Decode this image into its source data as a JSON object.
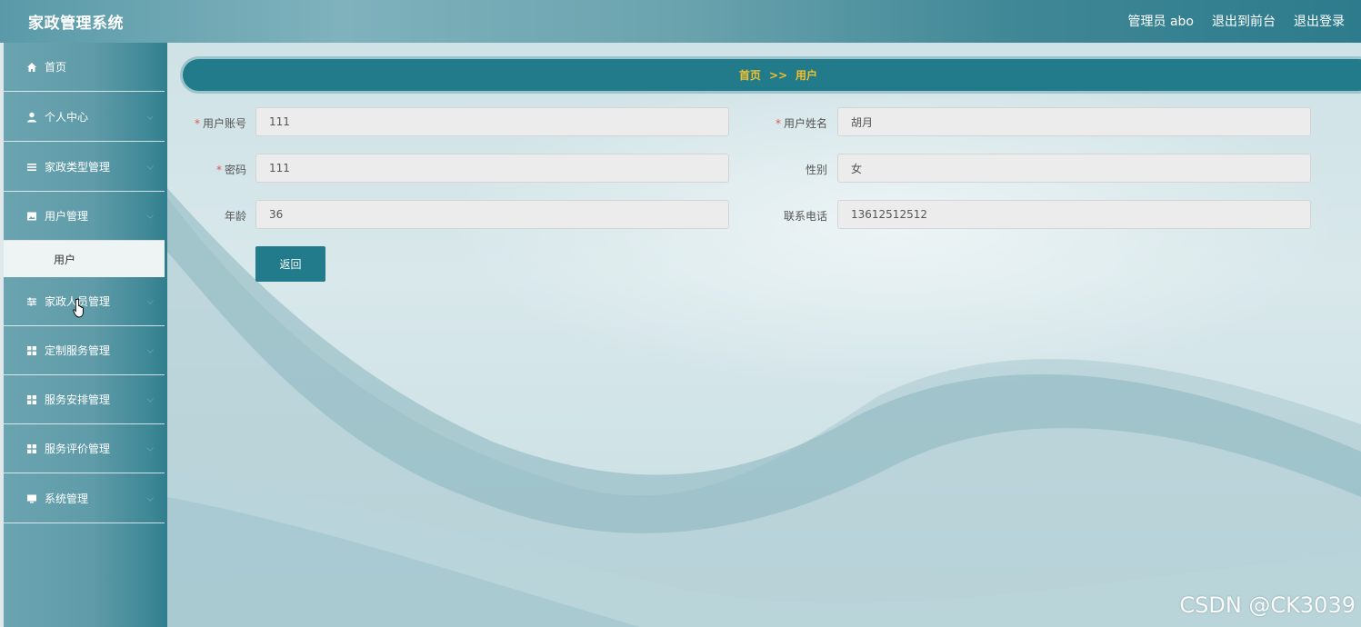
{
  "app": {
    "title": "家政管理系统"
  },
  "topbar": {
    "admin_label": "管理员 abo",
    "front_link": "退出到前台",
    "logout_link": "退出登录"
  },
  "sidebar": {
    "items": [
      {
        "label": "首页",
        "icon": "home-icon"
      },
      {
        "label": "个人中心",
        "icon": "user-icon"
      },
      {
        "label": "家政类型管理",
        "icon": "list-icon"
      },
      {
        "label": "用户管理",
        "icon": "image-icon"
      },
      {
        "label": "家政人员管理",
        "icon": "sliders-icon"
      },
      {
        "label": "定制服务管理",
        "icon": "grid-icon"
      },
      {
        "label": "服务安排管理",
        "icon": "grid-icon"
      },
      {
        "label": "服务评价管理",
        "icon": "grid-icon"
      },
      {
        "label": "系统管理",
        "icon": "monitor-icon"
      }
    ],
    "active_sub_item": "用户"
  },
  "breadcrumb": {
    "home": "首页",
    "separator": ">>",
    "current": "用户"
  },
  "form": {
    "account": {
      "label": "用户账号",
      "value": "111",
      "required": true
    },
    "name": {
      "label": "用户姓名",
      "value": "胡月",
      "required": true
    },
    "password": {
      "label": "密码",
      "value": "111",
      "required": true
    },
    "gender": {
      "label": "性别",
      "value": "女",
      "required": false
    },
    "age": {
      "label": "年龄",
      "value": "36",
      "required": false
    },
    "phone": {
      "label": "联系电话",
      "value": "13612512512",
      "required": false
    },
    "back_button": "返回"
  },
  "watermark": "CSDN @CK3039",
  "colors": {
    "accent": "#217b8a",
    "breadcrumb_text": "#f2c02a",
    "required_mark": "#e0574f"
  }
}
